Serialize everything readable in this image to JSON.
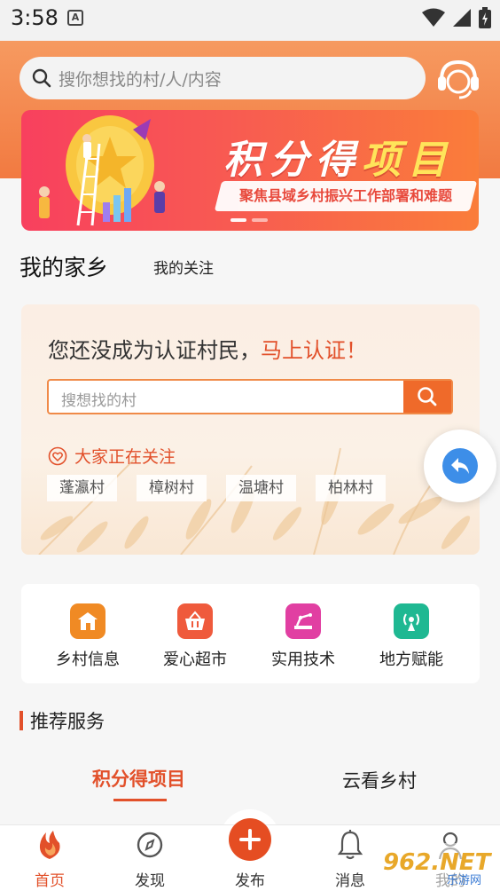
{
  "status_bar": {
    "time": "3:58",
    "notification_icon": "A"
  },
  "header": {
    "search_placeholder": "搜你想找的村/人/内容",
    "service_icon": "customer-service-icon"
  },
  "banner": {
    "title_part1": "积分得",
    "title_part2": "项目",
    "subtitle": "聚焦县域乡村振兴工作部署和难题",
    "slides_total": 2,
    "slide_active": 1
  },
  "home_tabs": {
    "my_hometown": "我的家乡",
    "my_follow": "我的关注"
  },
  "verify_card": {
    "prompt": "您还没成为认证村民，",
    "cta": "马上认证！",
    "search_placeholder": "搜想找的村",
    "trending_title": "大家正在关注",
    "villages": [
      "蓬瀛村",
      "樟树村",
      "温塘村",
      "柏林村"
    ]
  },
  "quick_actions": [
    {
      "label": "乡村信息",
      "icon": "house-icon",
      "color": "#f08a24"
    },
    {
      "label": "爱心超市",
      "icon": "basket-icon",
      "color": "#ef5a3c"
    },
    {
      "label": "实用技术",
      "icon": "machine-icon",
      "color": "#e13fa2"
    },
    {
      "label": "地方赋能",
      "icon": "signal-tower-icon",
      "color": "#1fb892"
    }
  ],
  "recommend": {
    "title": "推荐服务",
    "tabs": [
      "积分得项目",
      "云看乡村"
    ],
    "active_tab": 0
  },
  "bottom_nav": {
    "items": [
      "首页",
      "发现",
      "发布",
      "消息",
      "我的"
    ],
    "active": 0
  },
  "watermark": {
    "text_main": "962.NET",
    "text_sub": "乐游网"
  },
  "colors": {
    "accent": "#e2502a",
    "header": "#f27a41"
  }
}
